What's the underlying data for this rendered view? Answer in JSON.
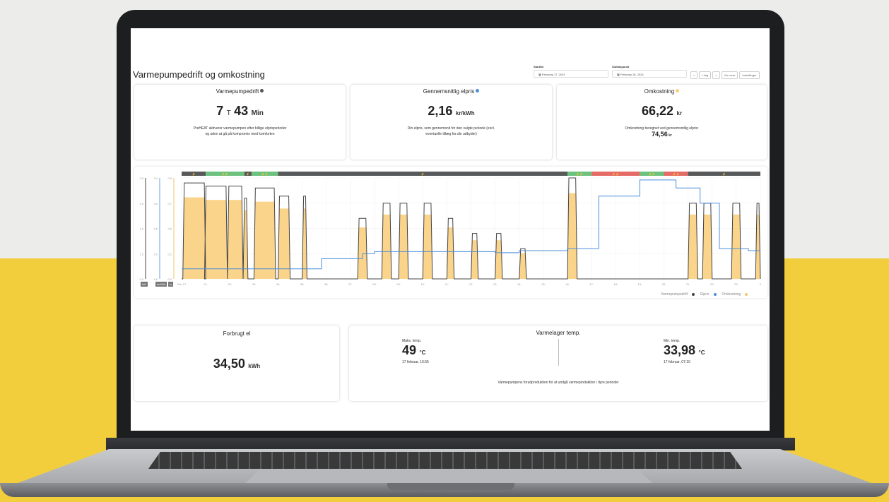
{
  "page": {
    "title": "Varmepumpedrift og omkostning"
  },
  "date_range": {
    "start_label": "Starttid",
    "start_value": "February 17, 2024",
    "end_label": "Slutidspunkt",
    "end_value": "February 18, 2024",
    "prev": "<",
    "today": "I dag",
    "next": ">",
    "more": "Vis mere",
    "settings": "Indstillinger"
  },
  "cards": {
    "operation": {
      "title": "Varmepumpedrift",
      "hours": "7",
      "hours_unit": "T",
      "minutes": "43",
      "minutes_unit": "Min",
      "desc1": "PreHEAT aktiverer varmepumpen efter billige elprisperioder",
      "desc2": "og uden at gå på kompromis med komforten",
      "dot_color": "#555555"
    },
    "price": {
      "title": "Gennemsnitlig elpris",
      "value": "2,16",
      "unit": "kr/kWh",
      "desc1": "Din elpris, som gennemsnit for den valgte periode (excl.",
      "desc2": "eventuelle tillæg fra din udbyder)",
      "dot_color": "#4a8fd9"
    },
    "cost": {
      "title": "Omkostning",
      "value": "66,22",
      "unit": "kr",
      "desc1": "Omkostning beregnet ved gennemsnitlig elpris:",
      "avg_value": "74,56",
      "avg_unit": "kr",
      "dot_color": "#f7d27a"
    }
  },
  "chart_data": {
    "type": "line",
    "x_ticks": [
      "Feb 17",
      "01:",
      "02:",
      "03:",
      "04:",
      "05:",
      "06:",
      "07:",
      "08:",
      "09:",
      "10:",
      "11:",
      "12:",
      "13:",
      "14:",
      "15:",
      "16:",
      "17:",
      "18:",
      "19:",
      "20:",
      "21:",
      "22:",
      "23:",
      "0"
    ],
    "axes": [
      {
        "tag": "kW",
        "ticks": [
          "3.0",
          "2.0",
          "1.0",
          "1.5",
          "0.0"
        ],
        "color": "#444444"
      },
      {
        "tag": "kr/kWh",
        "ticks": [
          "3.4",
          "3.0",
          "2.5",
          "2.0",
          "1.6"
        ],
        "color": "#6aa4e0"
      },
      {
        "tag": "kr",
        "ticks": [
          "0.9",
          "0.7",
          "0.5",
          "0.2",
          "0.0"
        ],
        "color": "#f2c55c"
      }
    ],
    "status_bar": [
      {
        "from": 0,
        "to": 1,
        "kind": "normal",
        "icon": "⚡"
      },
      {
        "from": 1,
        "to": 2.6,
        "kind": "green",
        "icon": "⚡⚡"
      },
      {
        "from": 2.6,
        "to": 2.9,
        "kind": "normal",
        "icon": "⚡"
      },
      {
        "from": 2.9,
        "to": 4,
        "kind": "green",
        "icon": "⚡⚡"
      },
      {
        "from": 4,
        "to": 16,
        "kind": "normal",
        "icon": "⚡"
      },
      {
        "from": 16,
        "to": 17,
        "kind": "green",
        "icon": "⚡⚡"
      },
      {
        "from": 17,
        "to": 19,
        "kind": "red",
        "icon": "⚡⚡"
      },
      {
        "from": 19,
        "to": 20,
        "kind": "green",
        "icon": "⚡⚡"
      },
      {
        "from": 20,
        "to": 21,
        "kind": "red",
        "icon": "⚡⚡"
      },
      {
        "from": 21,
        "to": 24,
        "kind": "normal",
        "icon": "⚡"
      }
    ],
    "series": [
      {
        "name": "Varmepumpedrift",
        "color": "#444444"
      },
      {
        "name": "Elpris",
        "color": "#4a8fd9"
      },
      {
        "name": "Omkostning",
        "color": "#f7c76a"
      }
    ],
    "pulses": [
      [
        0.05,
        1.0,
        0.95
      ],
      [
        0.95,
        1.9,
        0.92
      ],
      [
        1.9,
        2.55,
        0.92
      ],
      [
        2.55,
        2.75,
        0.8
      ],
      [
        3.0,
        3.9,
        0.9
      ],
      [
        4.0,
        4.5,
        0.82
      ],
      [
        5.0,
        5.2,
        0.82
      ],
      [
        7.3,
        7.7,
        0.6
      ],
      [
        8.3,
        8.7,
        0.75
      ],
      [
        9.0,
        9.4,
        0.75
      ],
      [
        10.0,
        10.4,
        0.75
      ],
      [
        11.0,
        11.3,
        0.6
      ],
      [
        12.0,
        12.3,
        0.45
      ],
      [
        13.0,
        13.3,
        0.45
      ],
      [
        14.0,
        14.3,
        0.3
      ],
      [
        16.0,
        16.4,
        1.0
      ],
      [
        21.0,
        21.4,
        0.75
      ],
      [
        21.6,
        22.0,
        0.75
      ],
      [
        22.8,
        23.2,
        0.75
      ],
      [
        23.8,
        24.0,
        0.75
      ]
    ],
    "price_steps": [
      [
        0,
        0.1
      ],
      [
        5.8,
        0.2
      ],
      [
        7.5,
        0.25
      ],
      [
        8,
        0.27
      ],
      [
        10,
        0.27
      ],
      [
        13,
        0.26
      ],
      [
        14,
        0.28
      ],
      [
        16,
        0.3
      ],
      [
        17.3,
        0.82
      ],
      [
        19,
        0.98
      ],
      [
        20.5,
        0.9
      ],
      [
        21.5,
        0.75
      ],
      [
        22.3,
        0.3
      ],
      [
        23.5,
        0.28
      ]
    ]
  },
  "bottom": {
    "consumption": {
      "title": "Forbrugt el",
      "value": "34,50",
      "unit": "kWh"
    },
    "storage": {
      "title": "Varmelager temp.",
      "max_label": "Maks. temp.",
      "max_value": "49",
      "max_unit": "°C",
      "max_time": "17 februar, 16:55",
      "min_label": "Min. temp.",
      "min_value": "33,98",
      "min_unit": "°C",
      "min_time": "17 februar, 07:10",
      "footer": "Varmepumpens forudproduktion for at undgå varmeproduktion i dyre perioder"
    }
  }
}
